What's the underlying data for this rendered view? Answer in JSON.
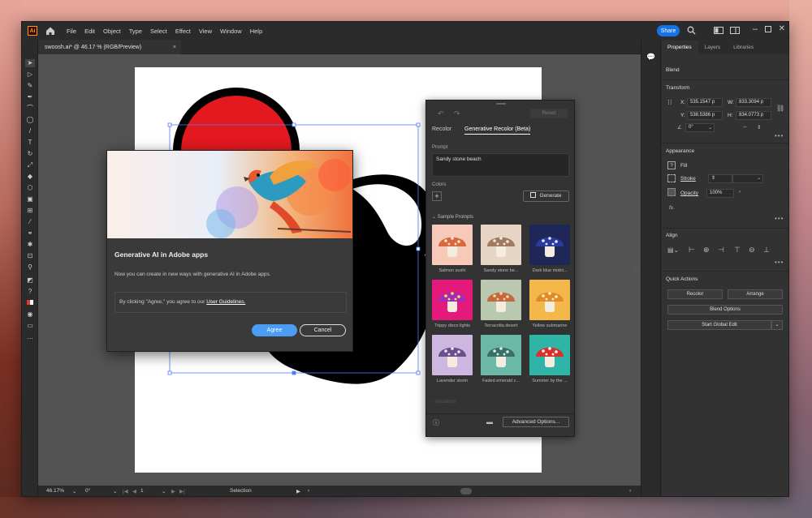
{
  "menubar": {
    "logo": "Ai",
    "items": [
      "File",
      "Edit",
      "Object",
      "Type",
      "Select",
      "Effect",
      "View",
      "Window",
      "Help"
    ],
    "share_label": "Share"
  },
  "document": {
    "tab_title": "swoosh.ai* @ 46.17 % (RGB/Preview)",
    "close": "×"
  },
  "statusbar": {
    "zoom": "46.17%",
    "rotation": "0°",
    "artboard": "1",
    "mode": "Selection"
  },
  "properties": {
    "tabs": [
      "Properties",
      "Layers",
      "Libraries"
    ],
    "blend_title": "Blend",
    "transform": {
      "title": "Transform",
      "x_label": "X:",
      "x": "535.1547 p",
      "y_label": "Y:",
      "y": "538.5386 p",
      "w_label": "W:",
      "w": "833.3094 p",
      "h_label": "H:",
      "h": "834.0773 p",
      "angle": "0°"
    },
    "appearance": {
      "title": "Appearance",
      "fill": "Fill",
      "stroke": "Stroke",
      "opacity_label": "Opacity",
      "opacity": "100%",
      "fx": "fx."
    },
    "align_title": "Align",
    "quick_actions": {
      "title": "Quick Actions",
      "recolor": "Recolor",
      "arrange": "Arrange",
      "blend_options": "Blend Options",
      "start_global_edit": "Start Global Edit"
    }
  },
  "generative_recolor": {
    "reset": "Reset",
    "tabs": [
      "Recolor",
      "Generative Recolor (Beta)"
    ],
    "prompt_label": "Prompt",
    "prompt_value": "Sandy stone beach",
    "colors_label": "Colors",
    "add": "+",
    "generate": "Generate",
    "sample_prompts_title": "Sample Prompts",
    "samples": [
      {
        "label": "Salmon sushi",
        "bg": "#f6c9b8",
        "cap": "#d8693e",
        "dot": "#f5e2d2"
      },
      {
        "label": "Sandy stone be...",
        "bg": "#e6d5c5",
        "cap": "#a07a63",
        "dot": "#f1e8de"
      },
      {
        "label": "Dark blue midni...",
        "bg": "#1f2758",
        "cap": "#2b3b9a",
        "dot": "#e8e8ff"
      },
      {
        "label": "Trippy disco lights",
        "bg": "#e3197b",
        "cap": "#a32bb8",
        "dot": "#ffe94a"
      },
      {
        "label": "Terracotta desert",
        "bg": "#b9c9b0",
        "cap": "#c46840",
        "dot": "#f2d6b0"
      },
      {
        "label": "Yellow submarine",
        "bg": "#f4b84a",
        "cap": "#e08a28",
        "dot": "#fff0c0"
      },
      {
        "label": "Lavender storm",
        "bg": "#cdb7e1",
        "cap": "#6c4f8e",
        "dot": "#f0e6ff"
      },
      {
        "label": "Faded emerald c...",
        "bg": "#6ab8a5",
        "cap": "#3b6f6a",
        "dot": "#d8f0e6"
      },
      {
        "label": "Summer by the ...",
        "bg": "#2fb5a8",
        "cap": "#d8302d",
        "dot": "#ffffff"
      }
    ],
    "variations_label": "Variations",
    "advanced_options": "Advanced Options..."
  },
  "dialog": {
    "title": "Generative AI in Adobe apps",
    "body": "Now you can create in new ways with generative AI in Adobe apps.",
    "guidelines_prefix": "By clicking \"Agree,\" you agree to our",
    "guidelines_link": "User Guidelines.",
    "agree": "Agree",
    "cancel": "Cancel"
  }
}
